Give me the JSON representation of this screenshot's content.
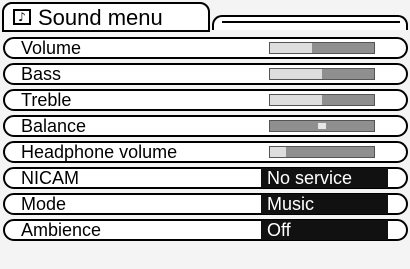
{
  "menu": {
    "title": "Sound menu",
    "title_icon": "music-note-icon",
    "items": [
      {
        "label": "Volume",
        "kind": "slider",
        "level": 0.4
      },
      {
        "label": "Bass",
        "kind": "slider",
        "level": 0.5
      },
      {
        "label": "Treble",
        "kind": "slider",
        "level": 0.5
      },
      {
        "label": "Balance",
        "kind": "balance",
        "level": 0.5
      },
      {
        "label": "Headphone volume",
        "kind": "slider",
        "level": 0.15
      },
      {
        "label": "NICAM",
        "kind": "value",
        "value": "No service"
      },
      {
        "label": "Mode",
        "kind": "value",
        "value": "Music"
      },
      {
        "label": "Ambience",
        "kind": "value",
        "value": "Off"
      }
    ]
  },
  "colors": {
    "value_box_bg": "#111111",
    "slider_track": "#8f8f8f",
    "slider_fill": "#dedede"
  }
}
